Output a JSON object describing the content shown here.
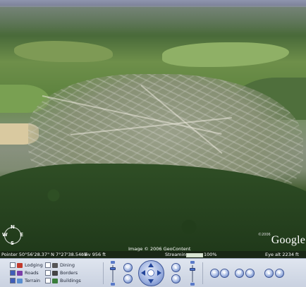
{
  "viewport": {
    "compass": {
      "n": "N",
      "s": "S",
      "w": "W",
      "e": "E"
    },
    "copyright": "Image © 2006 GeoContent",
    "logo": {
      "symbol": "©2006",
      "text": "Google"
    }
  },
  "status": {
    "pointer": "Pointer 50°56'28.37\" N   7°27'38.54\" E",
    "elevation": "elev  956 ft",
    "streaming_label": "Streaming",
    "streaming_percent": 100,
    "streaming_text": "100%",
    "eye_alt": "Eye alt   2234 ft"
  },
  "layers": [
    {
      "label": "Lodging",
      "checked": false,
      "icon_color": "#c0392b",
      "icon": "bed-icon"
    },
    {
      "label": "Roads",
      "checked": true,
      "icon_color": "#7a3fa8",
      "icon": "road-icon"
    },
    {
      "label": "Terrain",
      "checked": true,
      "icon_color": "#5a8fd0",
      "icon": "terrain-icon"
    },
    {
      "label": "Dining",
      "checked": false,
      "icon_color": "#555555",
      "icon": "fork-knife-icon"
    },
    {
      "label": "Borders",
      "checked": false,
      "icon_color": "#444444",
      "icon": "border-icon"
    },
    {
      "label": "Buildings",
      "checked": false,
      "icon_color": "#3a7d3a",
      "icon": "building-icon"
    }
  ],
  "controls": {
    "tilt_level": 0.15,
    "zoom_level": 0.2,
    "colors": {
      "accent": "#4a70c8",
      "panel": "#dfe5ef"
    }
  }
}
